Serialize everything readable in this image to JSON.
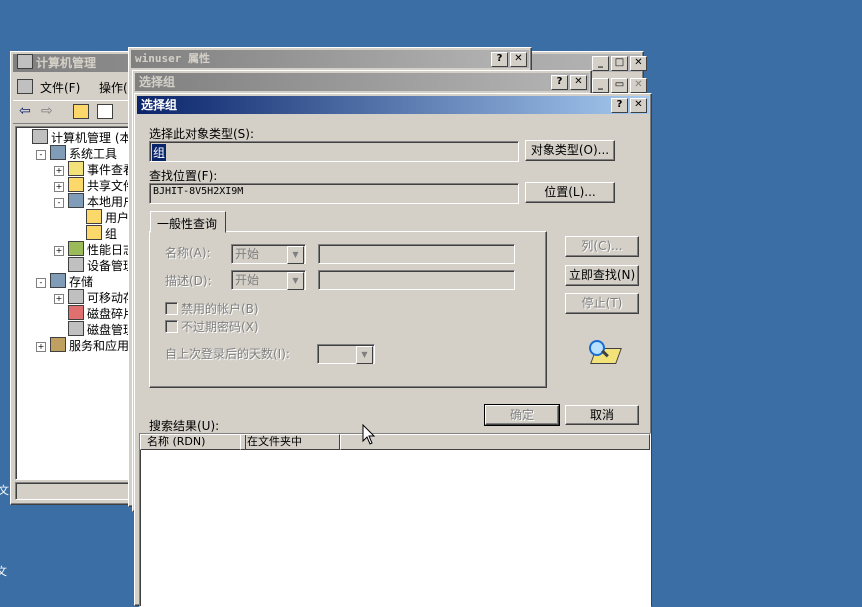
{
  "desktop": {
    "edge_texts": [
      "文",
      "文"
    ]
  },
  "mmc": {
    "title": "计算机管理",
    "menu": [
      "文件(F)",
      "操作("
    ],
    "tree": [
      {
        "label": "计算机管理 (本地",
        "indent": 0,
        "pm": ""
      },
      {
        "label": "系统工具",
        "indent": 1,
        "pm": "-"
      },
      {
        "label": "事件查看",
        "indent": 2,
        "pm": "+"
      },
      {
        "label": "共享文件",
        "indent": 2,
        "pm": "+"
      },
      {
        "label": "本地用户",
        "indent": 2,
        "pm": "-"
      },
      {
        "label": "用户",
        "indent": 3,
        "pm": ""
      },
      {
        "label": "组",
        "indent": 3,
        "pm": ""
      },
      {
        "label": "性能日志",
        "indent": 2,
        "pm": "+"
      },
      {
        "label": "设备管理",
        "indent": 2,
        "pm": ""
      },
      {
        "label": "存储",
        "indent": 1,
        "pm": "-"
      },
      {
        "label": "可移动存",
        "indent": 2,
        "pm": "+"
      },
      {
        "label": "磁盘碎片",
        "indent": 2,
        "pm": ""
      },
      {
        "label": "磁盘管理",
        "indent": 2,
        "pm": ""
      },
      {
        "label": "服务和应用程",
        "indent": 1,
        "pm": "+"
      }
    ]
  },
  "props_window": {
    "title": "winuser 属性",
    "buttons": [
      "?",
      "✕"
    ]
  },
  "select_group_back": {
    "title": "选择组",
    "buttons": [
      "?",
      "✕"
    ]
  },
  "mmc_controls": [
    "_",
    "□",
    "✕"
  ],
  "inner_controls": [
    "_",
    "▭",
    "✕"
  ],
  "dialog": {
    "title": "选择组",
    "buttons": [
      "?",
      "✕"
    ],
    "object_type_label": "选择此对象类型(S):",
    "object_type_value": "组",
    "object_type_button": "对象类型(O)...",
    "location_label": "查找位置(F):",
    "location_value": "BJHIT-8V5H2XI9M",
    "location_button": "位置(L)...",
    "tab_label": "一般性查询",
    "name_label": "名称(A):",
    "name_combo": "开始",
    "desc_label": "描述(D):",
    "desc_combo": "开始",
    "disabled_accounts": "禁用的帐户(B)",
    "no_expire_pwd": "不过期密码(X)",
    "days_since_logon": "自上次登录后的天数(I):",
    "columns_button": "列(C)...",
    "find_now_button": "立即查找(N)",
    "stop_button": "停止(T)",
    "ok_button": "确定",
    "cancel_button": "取消",
    "results_label": "搜索结果(U):",
    "results_columns": [
      "名称 (RDN)",
      "在文件夹中"
    ]
  }
}
